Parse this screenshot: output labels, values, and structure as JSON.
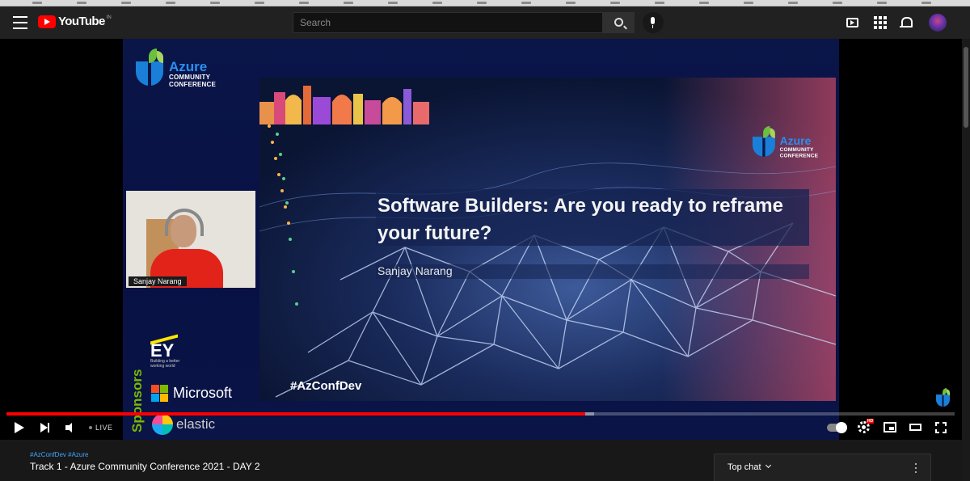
{
  "header": {
    "logo_text": "YouTube",
    "country_code": "IN",
    "search_placeholder": "Search",
    "icons": [
      "menu-icon",
      "search-icon",
      "mic-icon",
      "create-video-icon",
      "apps-icon",
      "bell-icon",
      "avatar"
    ]
  },
  "video": {
    "conference_logo": {
      "title": "Azure",
      "line1": "COMMUNITY",
      "line2": "CONFERENCE"
    },
    "slide": {
      "title": "Software Builders: Are you ready to reframe your future?",
      "author": "Sanjay Narang",
      "hashtag": "#AzConfDev"
    },
    "camera": {
      "speaker_label": "Sanjay Narang"
    },
    "sponsors": {
      "label": "Sponsors",
      "ey_name": "EY",
      "ey_tagline": "Building a better working world",
      "microsoft": "Microsoft",
      "elastic": "elastic"
    },
    "colors": {
      "brand_red": "#ff0000",
      "azure_blue": "#1a7fd8",
      "azure_green": "#6cbf3f",
      "sponsors_green": "#7ab800"
    }
  },
  "controls": {
    "live_label": "LIVE",
    "played_fraction": 0.61,
    "loaded_fraction": 0.62,
    "hd_badge": "HD",
    "icons": [
      "play-icon",
      "next-icon",
      "volume-icon",
      "autoplay-toggle",
      "settings-gear-icon",
      "miniplayer-icon",
      "theater-icon",
      "fullscreen-icon"
    ]
  },
  "below": {
    "tags": "#AzConfDev #Azure",
    "title": "Track 1 - Azure Community Conference 2021 - DAY 2",
    "chat_label": "Top chat"
  }
}
